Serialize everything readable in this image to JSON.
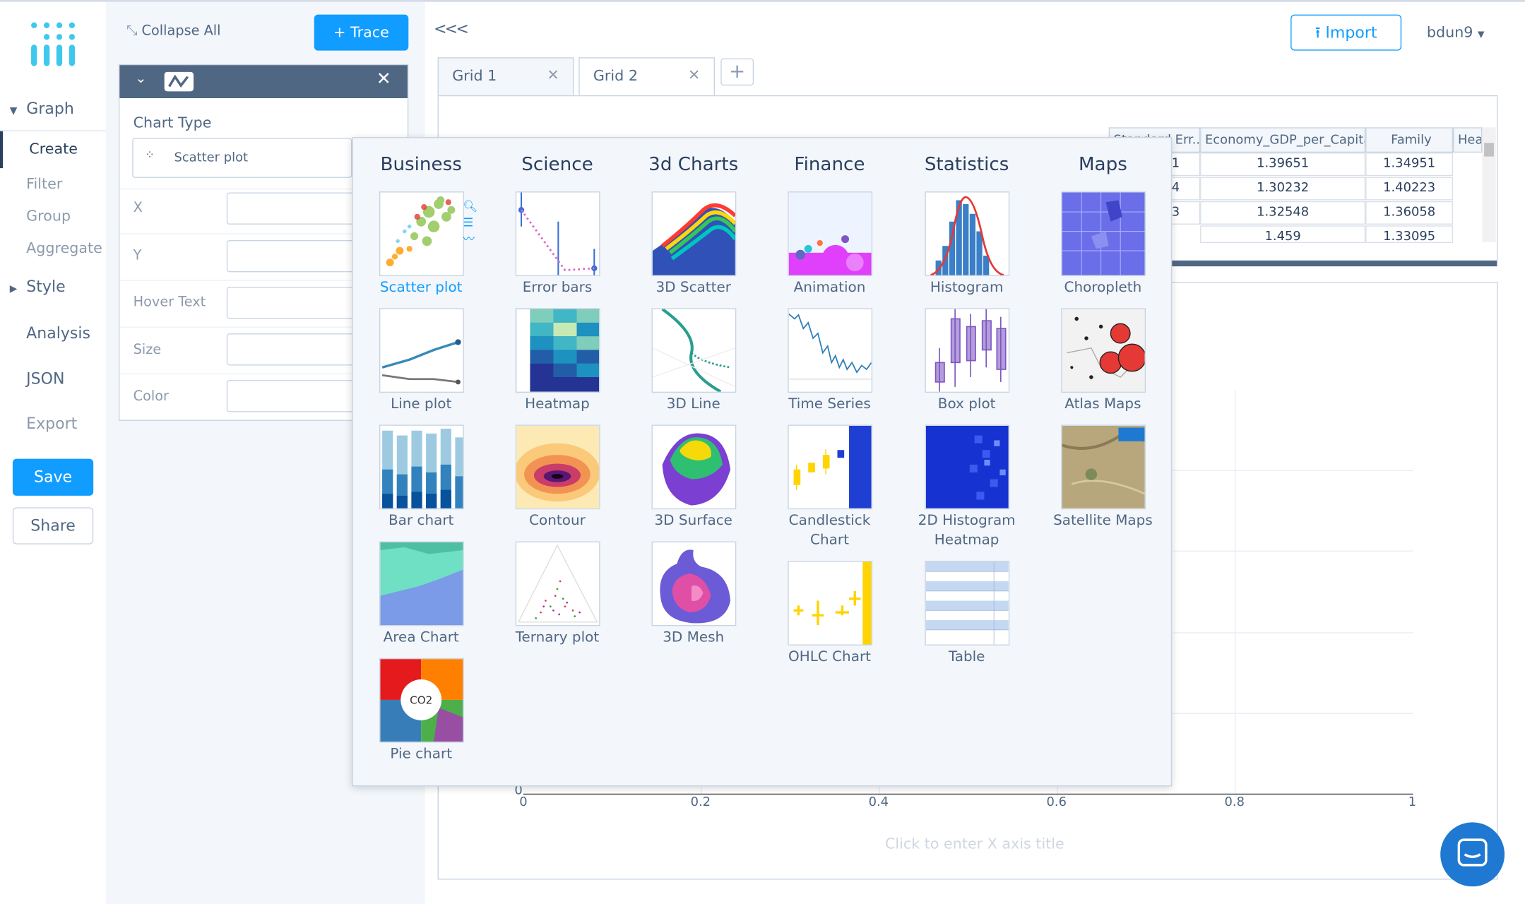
{
  "nav": {
    "graph": "Graph",
    "create": "Create",
    "filter": "Filter",
    "group": "Group",
    "aggregate": "Aggregate",
    "style": "Style",
    "analysis": "Analysis",
    "json": "JSON",
    "export": "Export",
    "save": "Save",
    "share": "Share"
  },
  "panel": {
    "collapse_all": "Collapse All",
    "add_trace": "+ Trace",
    "chart_type_label": "Chart Type",
    "chart_type_value": "Scatter plot",
    "fields": [
      "X",
      "Y",
      "Hover Text",
      "Size",
      "Color"
    ]
  },
  "header": {
    "collapse": "<<<",
    "import": "Import",
    "user": "bdun9"
  },
  "tabs": [
    {
      "label": "Grid 1",
      "close": "✕"
    },
    {
      "label": "Grid 2",
      "close": "✕"
    }
  ],
  "tab_add": "+",
  "grid": {
    "headers": [
      "Standard Err...",
      "Economy_GDP_per_Capita",
      "Family",
      "Hea"
    ],
    "rows": [
      [
        "1",
        "1.39651",
        "1.34951"
      ],
      [
        "4",
        "1.30232",
        "1.40223"
      ],
      [
        "3",
        "1.32548",
        "1.36058"
      ],
      [
        "",
        "1.459",
        "1.33095"
      ]
    ]
  },
  "plot": {
    "x_ticks": [
      "0",
      "0.2",
      "0.4",
      "0.6",
      "0.8",
      "1"
    ],
    "y_zero": "0",
    "x_axis_title": "Click to enter X axis title"
  },
  "chart_picker": {
    "categories": [
      "Business",
      "Science",
      "3d Charts",
      "Finance",
      "Statistics",
      "Maps"
    ],
    "columns": [
      [
        "Scatter plot",
        "Line plot",
        "Bar chart",
        "Area Chart",
        "Pie chart"
      ],
      [
        "Error bars",
        "Heatmap",
        "Contour",
        "Ternary plot"
      ],
      [
        "3D Scatter",
        "3D Line",
        "3D Surface",
        "3D Mesh"
      ],
      [
        "Animation",
        "Time Series",
        "Candlestick Chart",
        "OHLC Chart"
      ],
      [
        "Histogram",
        "Box plot",
        "2D Histogram Heatmap",
        "Table"
      ],
      [
        "Choropleth",
        "Atlas Maps",
        "Satellite Maps"
      ]
    ],
    "selected": "Scatter plot",
    "pie_center_label": "CO2"
  },
  "colors": {
    "accent": "#119dff",
    "nav_dark": "#506784",
    "panel_bg": "#f3f6fa"
  },
  "icons": {
    "logo": "plotly-logo",
    "collapse": "collapse-arrows-icon",
    "import": "upload-icon",
    "chat": "chat-icon"
  }
}
